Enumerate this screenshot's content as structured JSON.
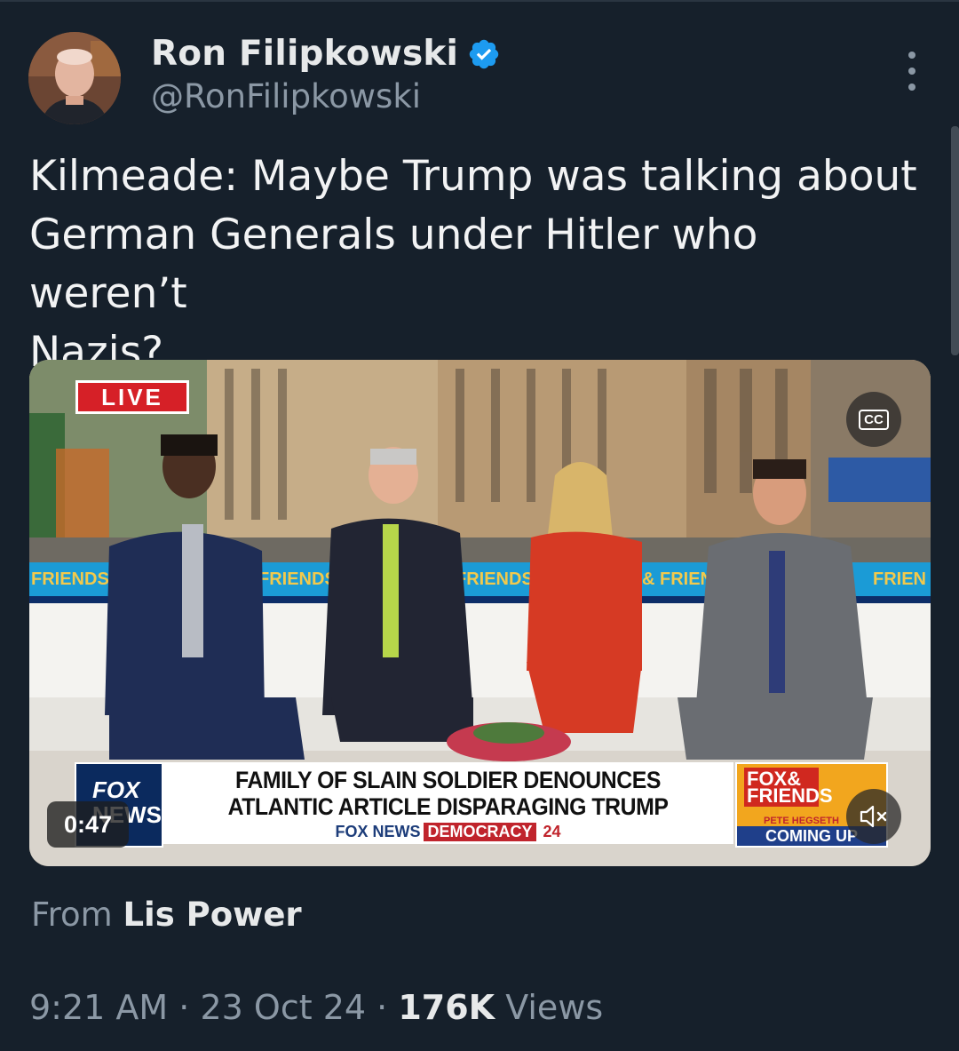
{
  "author": {
    "display_name": "Ron Filipkowski",
    "handle": "@RonFilipkowski",
    "verified": true,
    "avatar_icon": "user-avatar-photo",
    "verified_color": "#1d9bf0"
  },
  "tweet": {
    "text_line1": "Kilmeade: Maybe Trump was talking about",
    "text_line2": "German Generals under Hitler who weren’t",
    "text_line3": "Nazis?"
  },
  "video": {
    "live_badge": "LIVE",
    "cc_label": "CC",
    "timecode": "0:47",
    "mute_icon": "speaker-muted-icon",
    "chyron": {
      "network_line1": "FOX",
      "network_line2": "NEWS",
      "headline_line1": "FAMILY OF SLAIN SOLDIER DENOUNCES",
      "headline_line2": "ATLANTIC ARTICLE DISPARAGING TRUMP",
      "sub_brand": "FOX NEWS",
      "sub_tag": "DEMOCRACY",
      "sub_year": "24",
      "show_logo_line1": "FOX&",
      "show_logo_line2": "FRIENDS",
      "guest_name": "PETE HEGSETH",
      "coming_up": "COMING UP"
    },
    "set_banner_text": "FRIENDS"
  },
  "attribution": {
    "prefix": "From",
    "source": "Lis Power"
  },
  "meta": {
    "time": "9:21 AM",
    "date": "23 Oct 24",
    "views_count": "176K",
    "views_label": "Views",
    "separator": "·"
  },
  "colors": {
    "background": "#16202b",
    "text_primary": "#e7e9ea",
    "text_secondary": "#8b98a5"
  }
}
